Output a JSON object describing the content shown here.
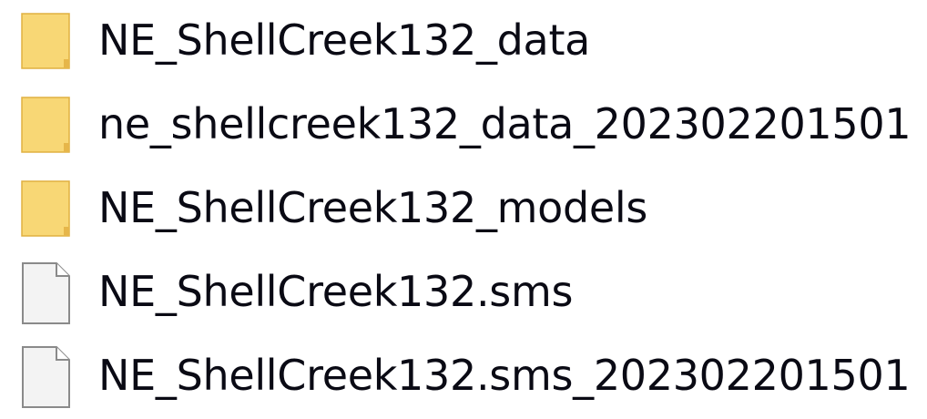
{
  "files": [
    {
      "name": "NE_ShellCreek132_data",
      "icon": "folder-icon"
    },
    {
      "name": "ne_shellcreek132_data_202302201501",
      "icon": "folder-icon"
    },
    {
      "name": "NE_ShellCreek132_models",
      "icon": "folder-icon"
    },
    {
      "name": "NE_ShellCreek132.sms",
      "icon": "file-icon"
    },
    {
      "name": "NE_ShellCreek132.sms_202302201501",
      "icon": "file-icon"
    }
  ],
  "colors": {
    "folder": "#f8d775",
    "folder_edge": "#e0b040",
    "file": "#f3f3f3",
    "file_edge": "#8a8a8a",
    "text": "#0a0a14"
  }
}
